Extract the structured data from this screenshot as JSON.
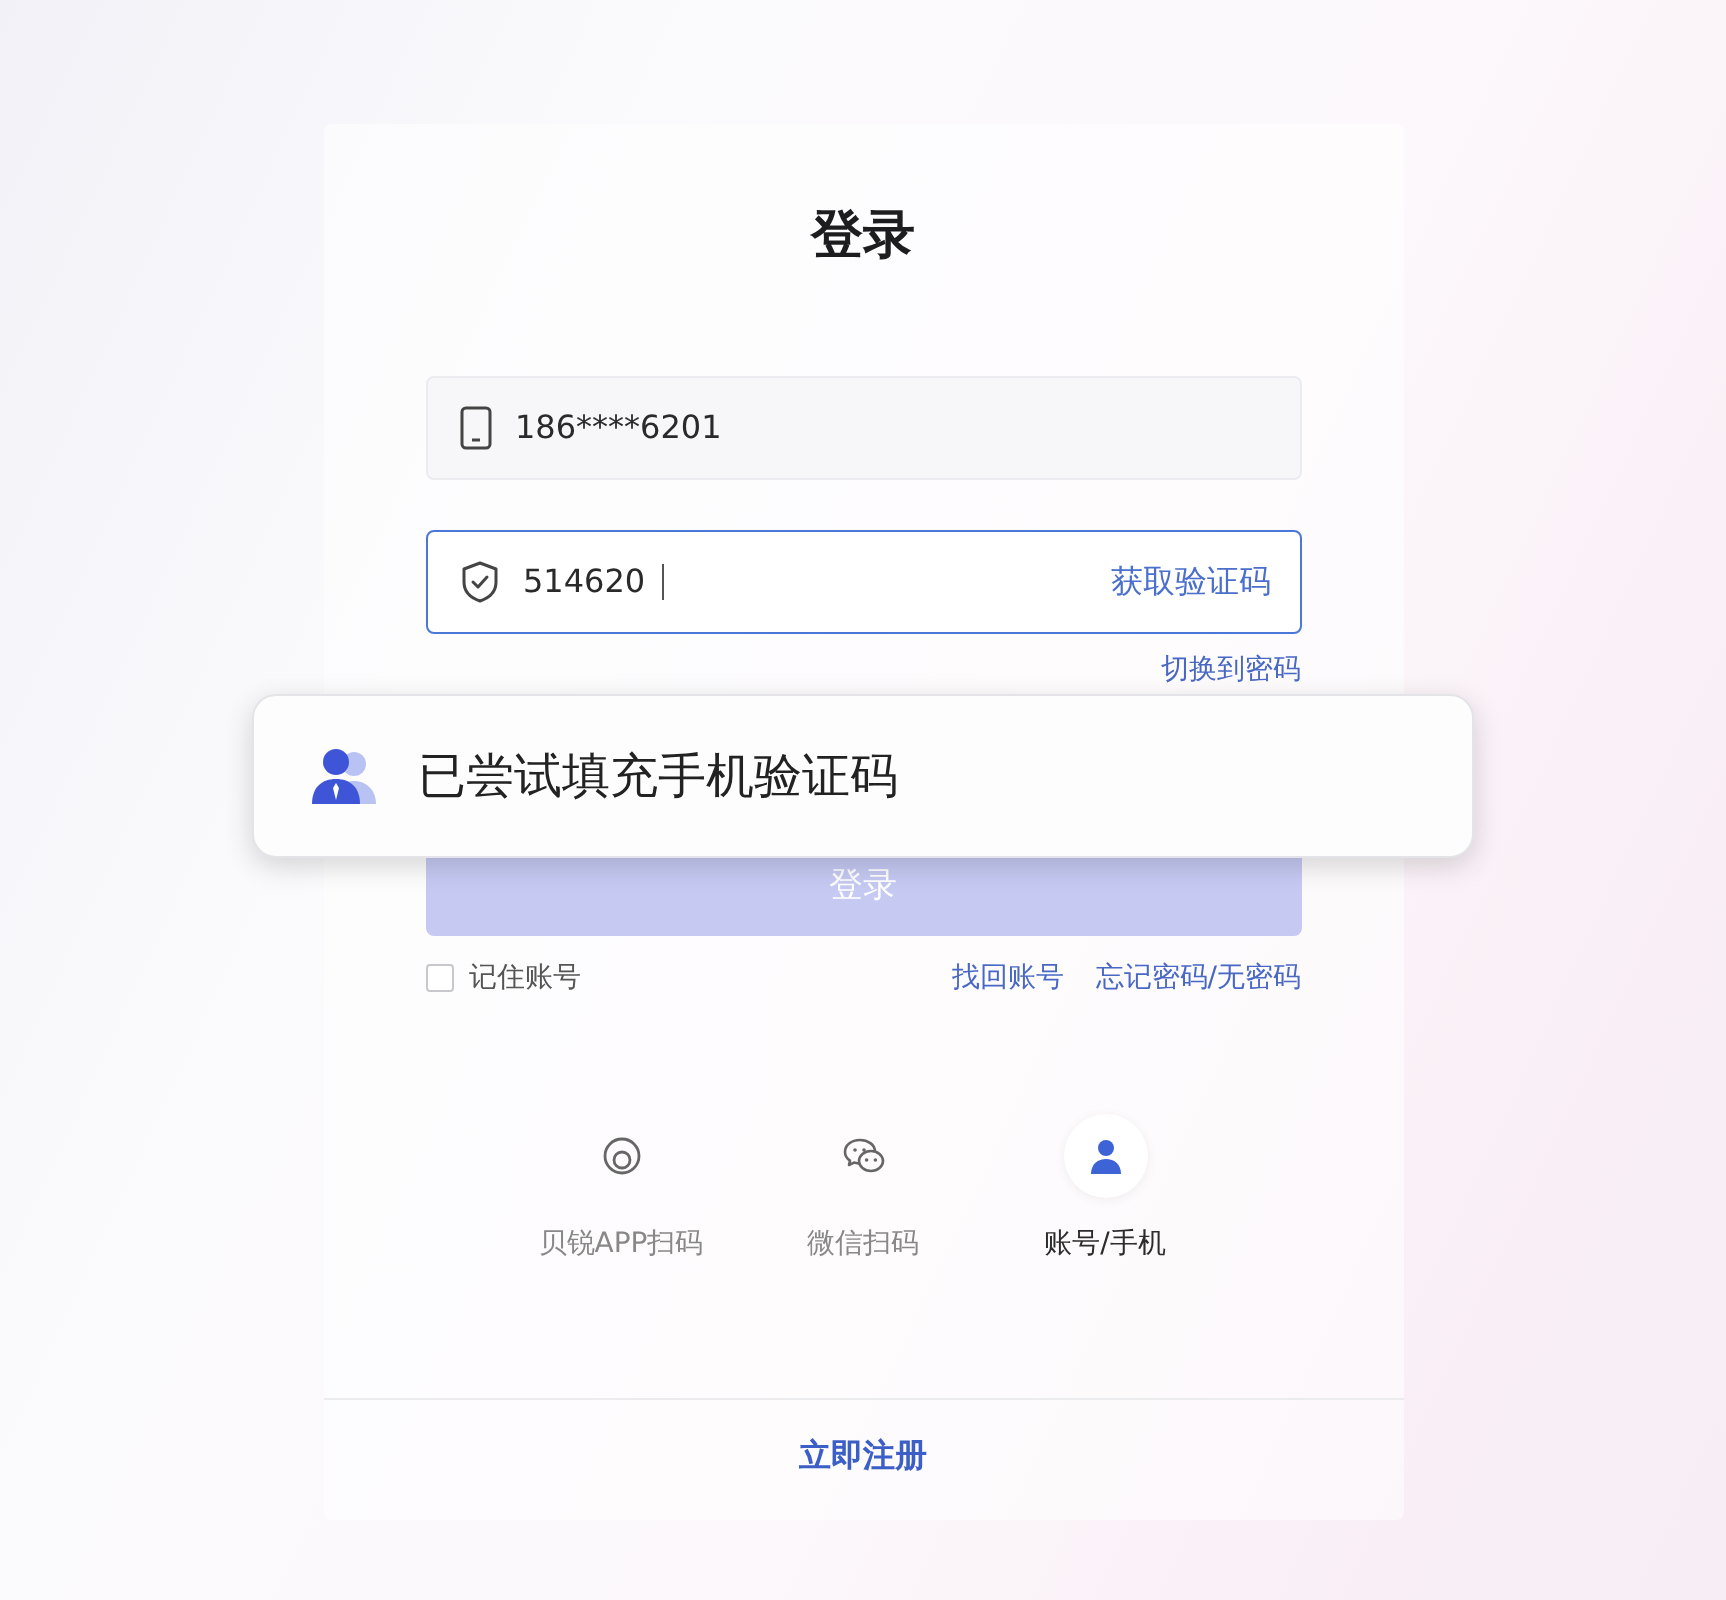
{
  "title": "登录",
  "phone_field": {
    "value": "186****6201"
  },
  "code_field": {
    "value": "514620",
    "focused": true,
    "action": "获取验证码"
  },
  "switch_link": "切换到密码",
  "login_button": {
    "label": "登录",
    "disabled": true
  },
  "remember": {
    "label": "记住账号",
    "checked": false
  },
  "links": [
    "找回账号",
    "忘记密码/无密码"
  ],
  "login_methods": [
    {
      "kind": "app",
      "label": "贝锐APP扫码",
      "selected": false
    },
    {
      "kind": "wechat",
      "label": "微信扫码",
      "selected": false
    },
    {
      "kind": "account",
      "label": "账号/手机",
      "selected": true
    }
  ],
  "register_link": "立即注册",
  "toast": {
    "message": "已尝试填充手机验证码"
  }
}
